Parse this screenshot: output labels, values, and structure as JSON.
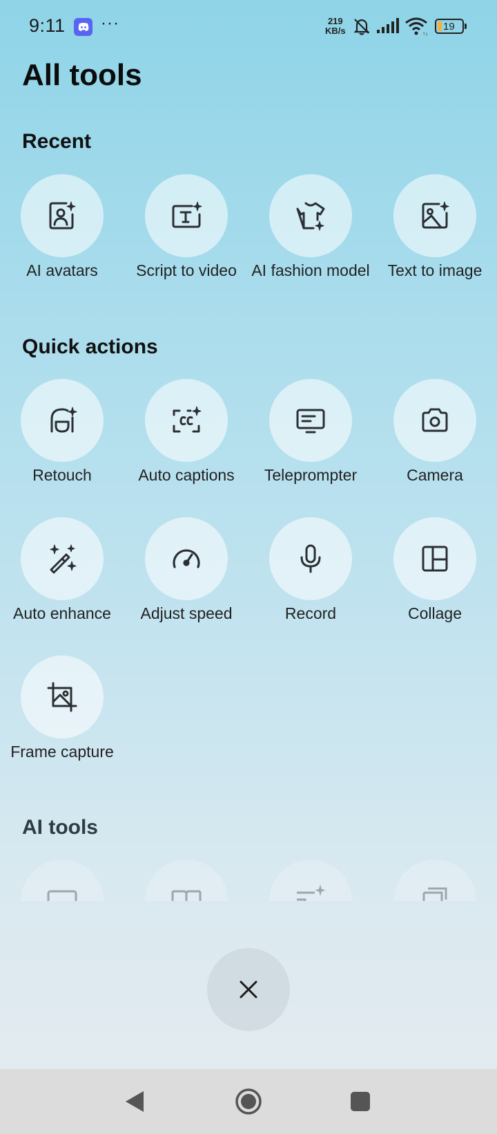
{
  "status_bar": {
    "time": "9:11",
    "more": "···",
    "net_speed_value": "219",
    "net_speed_unit": "KB/s",
    "battery": "19",
    "icons": [
      "discord-icon",
      "bell-muted-icon",
      "signal-icon",
      "wifi-icon",
      "battery-icon"
    ]
  },
  "title": "All tools",
  "sections": {
    "recent": {
      "title": "Recent",
      "items": [
        {
          "label": "AI avatars",
          "icon": "ai-avatar-icon"
        },
        {
          "label": "Script to video",
          "icon": "script-text-icon"
        },
        {
          "label": "AI fashion model",
          "icon": "shirt-icon"
        },
        {
          "label": "Text to image",
          "icon": "image-sparkle-icon"
        }
      ]
    },
    "quick_actions": {
      "title": "Quick actions",
      "items": [
        {
          "label": "Retouch",
          "icon": "face-sparkle-icon"
        },
        {
          "label": "Auto captions",
          "icon": "captions-icon"
        },
        {
          "label": "Teleprompter",
          "icon": "teleprompter-icon"
        },
        {
          "label": "Camera",
          "icon": "camera-icon"
        },
        {
          "label": "Auto enhance",
          "icon": "magic-wand-icon"
        },
        {
          "label": "Adjust speed",
          "icon": "speedometer-icon"
        },
        {
          "label": "Record",
          "icon": "microphone-icon"
        },
        {
          "label": "Collage",
          "icon": "collage-icon"
        },
        {
          "label": "Frame capture",
          "icon": "frame-crop-icon"
        }
      ]
    },
    "ai_tools": {
      "title": "AI tools"
    }
  },
  "close_icon": "close-icon",
  "nav": {
    "icons": [
      "back-icon",
      "home-icon",
      "recents-icon"
    ]
  },
  "colors": {
    "icon": "#2b2f33",
    "discord": "#5865f2",
    "battery_fill": "#f2b13a"
  }
}
